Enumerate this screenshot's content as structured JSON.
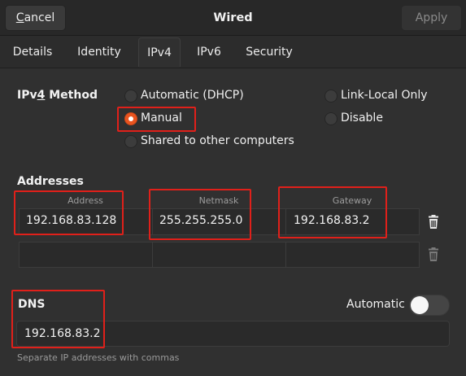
{
  "header": {
    "cancel_mnemonic": "C",
    "cancel_rest": "ancel",
    "title": "Wired",
    "apply_label": "Apply"
  },
  "tabs": [
    {
      "label": "Details"
    },
    {
      "label": "Identity"
    },
    {
      "label": "IPv4",
      "active": true
    },
    {
      "label": "IPv6"
    },
    {
      "label": "Security"
    }
  ],
  "ipv4": {
    "method_label_pre": "IPv",
    "method_label_mnemonic": "4",
    "method_label_post": " Method",
    "options": [
      {
        "label": "Automatic (DHCP)",
        "checked": false
      },
      {
        "label": "Manual",
        "checked": true
      },
      {
        "label": "Shared to other computers",
        "checked": false
      },
      {
        "label": "Link-Local Only",
        "checked": false
      },
      {
        "label": "Disable",
        "checked": false
      }
    ]
  },
  "addresses": {
    "section_label": "Addresses",
    "columns": [
      "Address",
      "Netmask",
      "Gateway"
    ],
    "rows": [
      {
        "address": "192.168.83.128",
        "netmask": "255.255.255.0",
        "gateway": "192.168.83.2"
      },
      {
        "address": "",
        "netmask": "",
        "gateway": ""
      }
    ]
  },
  "dns": {
    "section_label": "DNS",
    "automatic_label": "Automatic",
    "automatic_on": false,
    "value": "192.168.83.2",
    "hint": "Separate IP addresses with commas"
  },
  "colors": {
    "accent": "#e9541f",
    "annotation": "#e0201a"
  }
}
